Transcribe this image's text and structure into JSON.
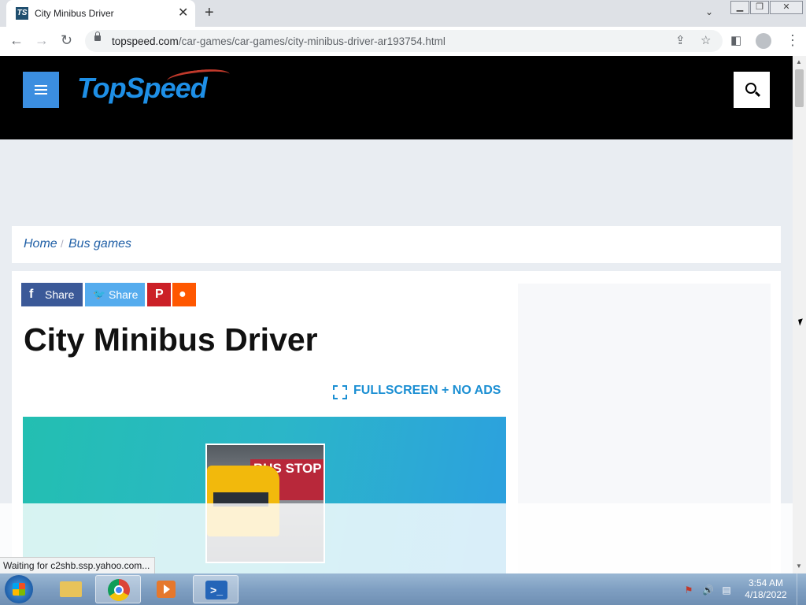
{
  "browser": {
    "tab": {
      "title": "City Minibus Driver",
      "favicon": "TS"
    },
    "new_tab_label": "+",
    "url": {
      "host": "topspeed.com",
      "path": "/car-games/car-games/city-minibus-driver-ar193754.html"
    }
  },
  "site": {
    "logo": "TopSpeed",
    "breadcrumb": [
      {
        "label": "Home"
      },
      {
        "label": "Bus games"
      }
    ],
    "breadcrumb_separator": "/",
    "share_buttons": [
      {
        "label": "Share",
        "icon": "facebook-icon",
        "glyph": "f",
        "color": "#3b5998"
      },
      {
        "label": "Share",
        "icon": "twitter-icon",
        "glyph": "🐦",
        "color": "#55acee"
      },
      {
        "label": "",
        "icon": "pinterest-icon",
        "glyph": "P",
        "color": "#cb2027"
      },
      {
        "label": "",
        "icon": "reddit-icon",
        "glyph": "●",
        "color": "#ff5700"
      }
    ],
    "page_title": "City Minibus Driver",
    "fullscreen_label": "FULLSCREEN + NO ADS",
    "thumbnail_text": "BUS STOP"
  },
  "status_bar": {
    "text": "Waiting for c2shb.ssp.yahoo.com..."
  },
  "taskbar": {
    "apps": [
      "windows-explorer",
      "chrome",
      "media-player",
      "powershell"
    ],
    "clock": {
      "time": "3:54 AM",
      "date": "4/18/2022"
    }
  },
  "colors": {
    "accent": "#3b8ee0",
    "header_bg": "#000000",
    "link": "#1f5fa6",
    "fullscreen": "#1b8fd3"
  }
}
